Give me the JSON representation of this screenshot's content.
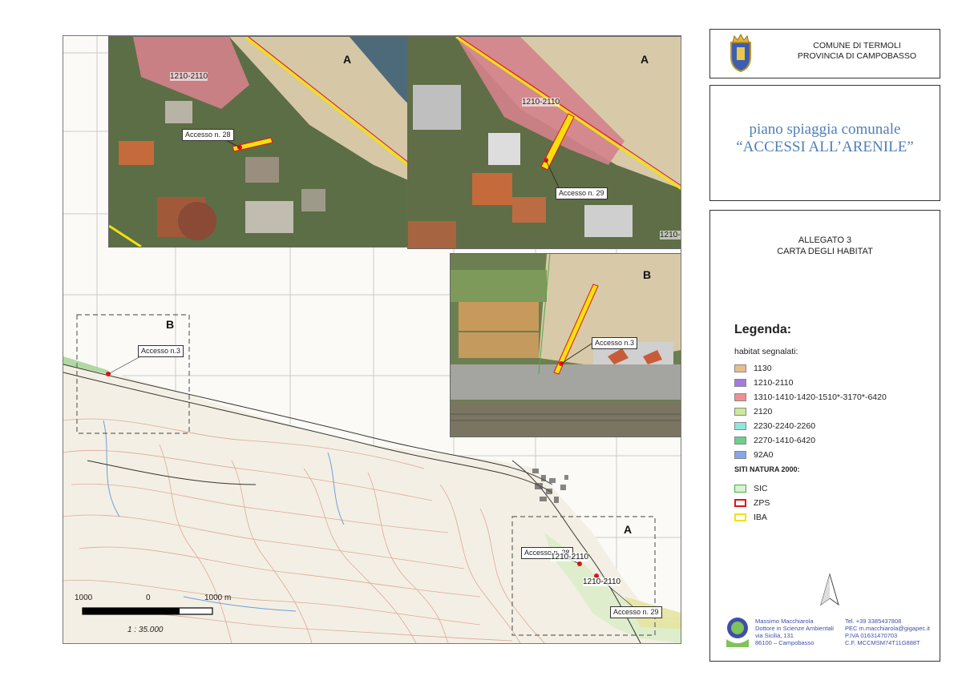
{
  "header": {
    "comune": "COMUNE DI TERMOLI",
    "provincia": "PROVINCIA DI CAMPOBASSO"
  },
  "title": {
    "line1": "piano spiaggia comunale",
    "line2": "“ACCESSI ALL’ARENILE”"
  },
  "allegato": {
    "line1": "ALLEGATO 3",
    "line2": "CARTA DEGLI HABITAT"
  },
  "legend": {
    "title": "Legenda:",
    "subtitle": "habitat segnalati:",
    "habitats": [
      {
        "label": "1130",
        "color": "#e3bf8e"
      },
      {
        "label": "1210-2110",
        "color": "#a37be0"
      },
      {
        "label": "1310-1410-1420-1510*-3170*-6420",
        "color": "#ef8f95"
      },
      {
        "label": "2120",
        "color": "#cce89a"
      },
      {
        "label": "2230-2240-2260",
        "color": "#8fe6dc"
      },
      {
        "label": "2270-1410-6420",
        "color": "#6dcf8c"
      },
      {
        "label": "92A0",
        "color": "#86a8e6"
      }
    ],
    "natura_title": "SITI NATURA 2000:",
    "natura": [
      {
        "label": "SIC",
        "color": "#d9f2d0",
        "border": "#4caa47"
      },
      {
        "label": "ZPS",
        "color": "#ffffff",
        "border": "#e01515"
      },
      {
        "label": "IBA",
        "color": "#ffffff",
        "border": "#f3e10e"
      }
    ]
  },
  "credits": {
    "name": "Massimo Macchiarola",
    "role": "Dottore in Scienze Ambientali",
    "address": "via Sicilia, 131",
    "city": "86100 – Campobasso",
    "tel": "Tel. +39 3385437808",
    "pec": "PEC m.macchiarola@gigapec.it",
    "piva": "P.IVA 01631470703",
    "cf": "C.F. MCCMSM74T11G888T"
  },
  "map": {
    "areas": {
      "a": "A",
      "b": "B"
    },
    "labels": {
      "accesso28": "Accesso n. 28",
      "accesso29": "Accesso n. 29",
      "accesso3": "Accesso n.3",
      "accesso3_small": "Accesso n.3",
      "habitat_a": "1210-2110",
      "habitat_b": "1210-2110",
      "habitat_c": "1210-",
      "main_hab1": "1210-2110",
      "main_hab2": "1210-2110",
      "main_acc28": "Accesso n. 28",
      "main_acc29": "Accesso n. 29",
      "main_acc3": "Accesso n.3"
    },
    "scale": {
      "left": "1000",
      "mid": "0",
      "right": "1000 m",
      "ratio": "1 : 35.000"
    }
  }
}
